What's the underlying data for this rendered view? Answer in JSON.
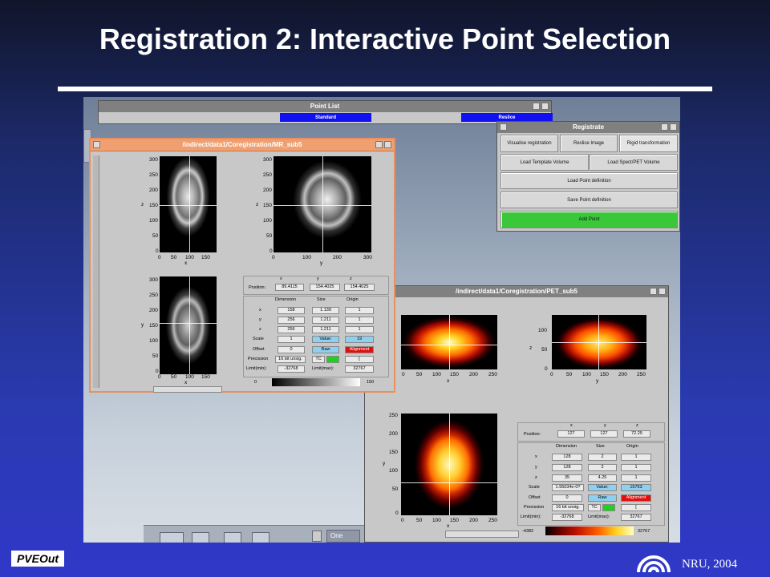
{
  "slide": {
    "title": "Registration 2: Interactive Point Selection",
    "logo_left_text": "PVEOut",
    "credit": "NRU, 2004"
  },
  "point_list": {
    "title": "Point List",
    "buttons": [
      "Standard",
      "Reslice"
    ]
  },
  "registrate": {
    "title": "Registrate",
    "tabs": [
      "Visualise registration",
      "Reslice Image",
      "Rigid transformation"
    ],
    "load_template": "Load Template Volume",
    "load_spect": "Load Spect/PET Volume",
    "load_point": "Load Point definition",
    "save_point": "Save Point definition",
    "add_point": "Add Point"
  },
  "mr_window": {
    "title": "/indirect/data1/Coregistration/MR_sub5",
    "coronal": {
      "yticks": [
        "300",
        "250",
        "200",
        "150",
        "100",
        "50",
        "0"
      ],
      "xticks": [
        "0",
        "50",
        "100",
        "150"
      ],
      "xlabel": "x",
      "ylabel": "z"
    },
    "sagittal": {
      "yticks": [
        "300",
        "250",
        "200",
        "150",
        "100",
        "50",
        "0"
      ],
      "xticks": [
        "0",
        "100",
        "200",
        "300"
      ],
      "xlabel": "y",
      "ylabel": "z"
    },
    "axial": {
      "yticks": [
        "300",
        "250",
        "200",
        "150",
        "100",
        "50",
        "0"
      ],
      "xticks": [
        "0",
        "50",
        "100",
        "150"
      ],
      "xlabel": "x",
      "ylabel": "y"
    },
    "position": {
      "label": "Position:",
      "headers": [
        "x",
        "y",
        "z"
      ],
      "values": [
        "89.4115",
        "154.4025",
        "154.4025"
      ]
    },
    "table": {
      "headers": [
        "Dimension",
        "Size",
        "Origin"
      ],
      "rows": [
        {
          "label": "x",
          "dim": "158",
          "size": "1.139",
          "origin": "1"
        },
        {
          "label": "y",
          "dim": "256",
          "size": "1.211",
          "origin": "1"
        },
        {
          "label": "z",
          "dim": "256",
          "size": "1.211",
          "origin": "1"
        }
      ],
      "scale_label": "Scale",
      "scale": "1",
      "value_label": "Value:",
      "value": "19",
      "offset_label": "Offset",
      "offset": "0",
      "raw": "Raw",
      "alignment": "Alignment",
      "precision_label": "Precission",
      "precision": "16 bit unsig.",
      "tc": "TC",
      "bracket": "[",
      "limit_min_label": "Limit(min):",
      "limit_min": "-32768",
      "limit_max_label": "Limit(max):",
      "limit_max": "32767"
    },
    "colorbar": {
      "min": "0",
      "max": "150"
    }
  },
  "pet_window": {
    "title": "/indirect/data1/Coregistration/PET_sub5",
    "coronal": {
      "xticks": [
        "0",
        "50",
        "100",
        "150",
        "200",
        "250"
      ],
      "xlabel": "x"
    },
    "sagittal": {
      "yticks": [
        "100",
        "50",
        "0"
      ],
      "xticks": [
        "0",
        "50",
        "100",
        "150",
        "200",
        "250"
      ],
      "xlabel": "y",
      "ylabel": "z"
    },
    "axial": {
      "yticks": [
        "250",
        "200",
        "150",
        "100",
        "50",
        "0"
      ],
      "xticks": [
        "0",
        "50",
        "100",
        "150",
        "200",
        "250"
      ],
      "xlabel": "x",
      "ylabel": "y"
    },
    "position": {
      "label": "Position:",
      "headers": [
        "x",
        "y",
        "z"
      ],
      "values": [
        "127",
        "127",
        "72.25"
      ]
    },
    "table": {
      "headers": [
        "Dimension",
        "Size",
        "Origin"
      ],
      "rows": [
        {
          "label": "x",
          "dim": "128",
          "size": "2",
          "origin": "1"
        },
        {
          "label": "y",
          "dim": "128",
          "size": "2",
          "origin": "1"
        },
        {
          "label": "z",
          "dim": "35",
          "size": "4.25",
          "origin": "1"
        }
      ],
      "scale_label": "Scale",
      "scale": "1.95034e-0?",
      "value_label": "Value:",
      "value": "15753",
      "offset_label": "Offset",
      "offset": "0",
      "raw": "Raw",
      "alignment": "Alignment",
      "precision_label": "Precission",
      "precision": "16 bit unsig.",
      "tc": "TC",
      "bracket": "[",
      "limit_min_label": "Limit(min):",
      "limit_min": "-32768",
      "limit_max_label": "Limit(max):",
      "limit_max": "32767"
    },
    "colorbar": {
      "min": "-4382",
      "max": "32767"
    }
  },
  "taskbar": {
    "label": "One"
  }
}
